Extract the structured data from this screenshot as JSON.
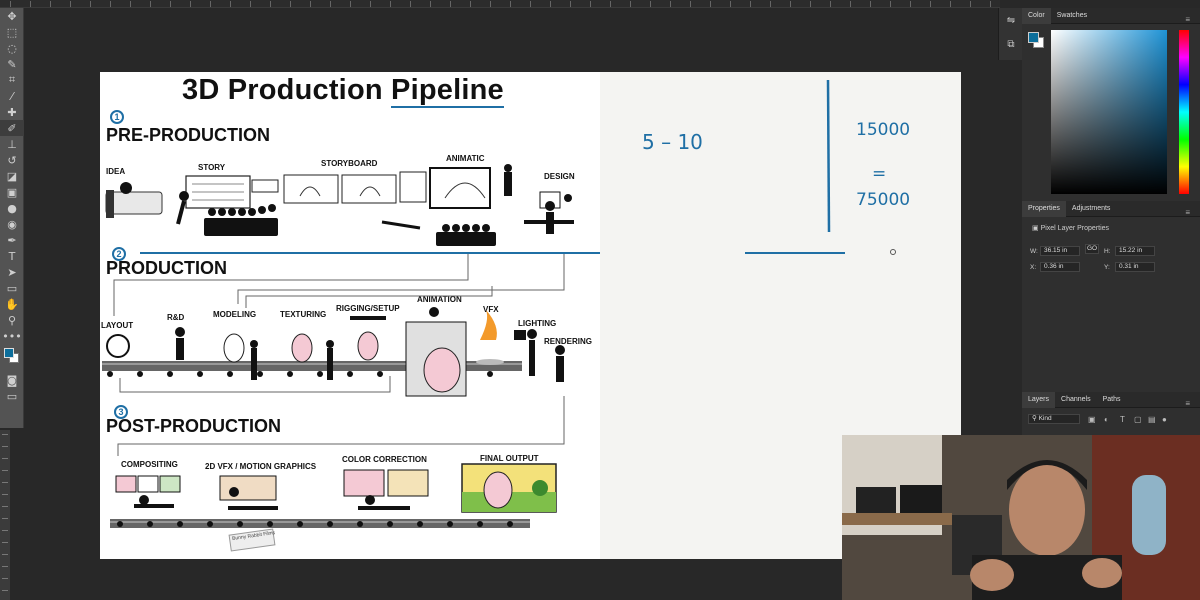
{
  "canvas": {
    "title_part1": "3D Production ",
    "title_part2": "Pipeline",
    "sections": {
      "pre": "PRE-PRODUCTION",
      "production": "PRODUCTION",
      "post": "POST-PRODUCTION"
    },
    "pre_labels": [
      "IDEA",
      "STORY",
      "STORYBOARD",
      "ANIMATIC",
      "DESIGN"
    ],
    "production_labels": [
      "LAYOUT",
      "R&D",
      "MODELING",
      "TEXTURING",
      "RIGGING/SETUP",
      "ANIMATION",
      "VFX",
      "LIGHTING",
      "RENDERING"
    ],
    "post_labels": [
      "COMPOSITING",
      "2D VFX / MOTION GRAPHICS",
      "COLOR CORRECTION",
      "FINAL OUTPUT"
    ],
    "stamp_text": "Bunny Rabbit Films",
    "annotations": {
      "num1": "1",
      "num2": "2",
      "num3": "3",
      "range": "5 – 10",
      "value_top": "15000",
      "equals": "=",
      "value_bottom": "75000"
    },
    "annotation_color": "#1f6fa5"
  },
  "panels": {
    "color_tabs": [
      "Color",
      "Swatches"
    ],
    "properties_tabs": [
      "Properties",
      "Adjustments"
    ],
    "properties_title": "Pixel Layer Properties",
    "W": "36.15 in",
    "H": "15.22 in",
    "X": "0.36 in",
    "Y": "0.31 in",
    "W_label": "W:",
    "H_label": "H:",
    "X_label": "X:",
    "Y_label": "Y:",
    "link_label": "GO",
    "layers_tabs": [
      "Layers",
      "Channels",
      "Paths"
    ],
    "kind_label": "Kind",
    "foreground_color": "#0c6e9b",
    "background_color": "#ffffff"
  },
  "toolbar": {
    "icons": [
      "move-icon",
      "marquee-icon",
      "lasso-icon",
      "quick-select-icon",
      "crop-icon",
      "eyedropper-icon",
      "healing-icon",
      "brush-icon",
      "stamp-icon",
      "history-brush-icon",
      "eraser-icon",
      "gradient-icon",
      "blur-icon",
      "dodge-icon",
      "pen-icon",
      "type-icon",
      "path-select-icon",
      "shape-icon",
      "hand-icon",
      "zoom-icon",
      "more-icon"
    ]
  }
}
